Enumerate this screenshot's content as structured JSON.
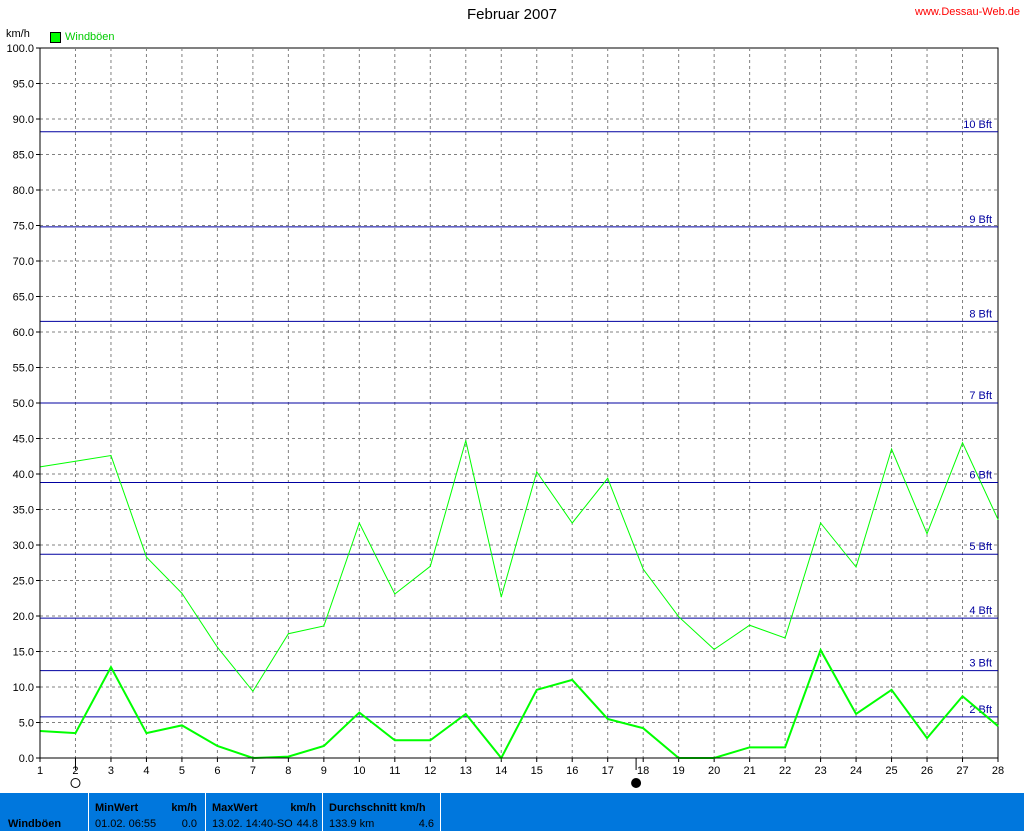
{
  "header": {
    "title": "Februar 2007",
    "site": "www.Dessau-Web.de",
    "unit": "km/h"
  },
  "colors": {
    "series": "#00ff00",
    "grid": "#808080",
    "bft": "#0000a0",
    "panel": "#0077dd"
  },
  "chart_data": {
    "type": "line",
    "title": "Februar 2007",
    "ylabel": "km/h",
    "xlim": [
      1,
      28
    ],
    "ylim": [
      0,
      100
    ],
    "x_ticks": [
      "1",
      "2",
      "3",
      "4",
      "5",
      "6",
      "7",
      "8",
      "9",
      "10",
      "11",
      "12",
      "13",
      "14",
      "15",
      "16",
      "17",
      "18",
      "19",
      "20",
      "21",
      "22",
      "23",
      "24",
      "25",
      "26",
      "27",
      "28"
    ],
    "y_ticks": [
      "0.0",
      "5.0",
      "10.0",
      "15.0",
      "20.0",
      "25.0",
      "30.0",
      "35.0",
      "40.0",
      "45.0",
      "50.0",
      "55.0",
      "60.0",
      "65.0",
      "70.0",
      "75.0",
      "80.0",
      "85.0",
      "90.0",
      "95.0",
      "100.0"
    ],
    "legend": "top-left",
    "grid": true,
    "series": [
      {
        "name": "Windböen",
        "values": [
          41.0,
          41.8,
          42.6,
          28.3,
          23.2,
          15.6,
          9.4,
          17.5,
          18.6,
          33.1,
          23.1,
          27.0,
          44.7,
          22.7,
          40.3,
          33.1,
          39.4,
          26.6,
          19.9,
          15.3,
          18.7,
          16.9,
          33.1,
          26.9,
          43.5,
          31.6,
          44.4,
          33.6
        ]
      },
      {
        "values": [
          3.8,
          3.5,
          12.8,
          3.5,
          4.6,
          1.7,
          0.0,
          0.2,
          1.7,
          6.4,
          2.5,
          2.5,
          6.2,
          0.0,
          9.6,
          11.0,
          5.5,
          4.2,
          0.0,
          0.0,
          1.5,
          1.5,
          15.2,
          6.2,
          9.6,
          2.8,
          8.7,
          4.5
        ]
      }
    ],
    "reference_lines": [
      {
        "label": "2 Bft",
        "value": 5.8
      },
      {
        "label": "3 Bft",
        "value": 12.3
      },
      {
        "label": "4 Bft",
        "value": 19.7
      },
      {
        "label": "5 Bft",
        "value": 28.7
      },
      {
        "label": "6 Bft",
        "value": 38.8
      },
      {
        "label": "7 Bft",
        "value": 50.0
      },
      {
        "label": "8 Bft",
        "value": 61.5
      },
      {
        "label": "9 Bft",
        "value": 74.8
      },
      {
        "label": "10 Bft",
        "value": 88.2
      }
    ],
    "moon_phases": [
      {
        "x": 2,
        "phase": "full"
      },
      {
        "x": 17.8,
        "phase": "new"
      }
    ]
  },
  "stats": {
    "label": "Windböen",
    "min": {
      "header": "MinWert",
      "unit": "km/h",
      "when": "01.02.  06:55",
      "value": "0.0"
    },
    "max": {
      "header": "MaxWert",
      "unit": "km/h",
      "when": "13.02.  14:40-SO",
      "value": "44.8"
    },
    "avg": {
      "header": "Durchschnitt km/h",
      "distance": "133.9 km",
      "value": "4.6"
    }
  }
}
